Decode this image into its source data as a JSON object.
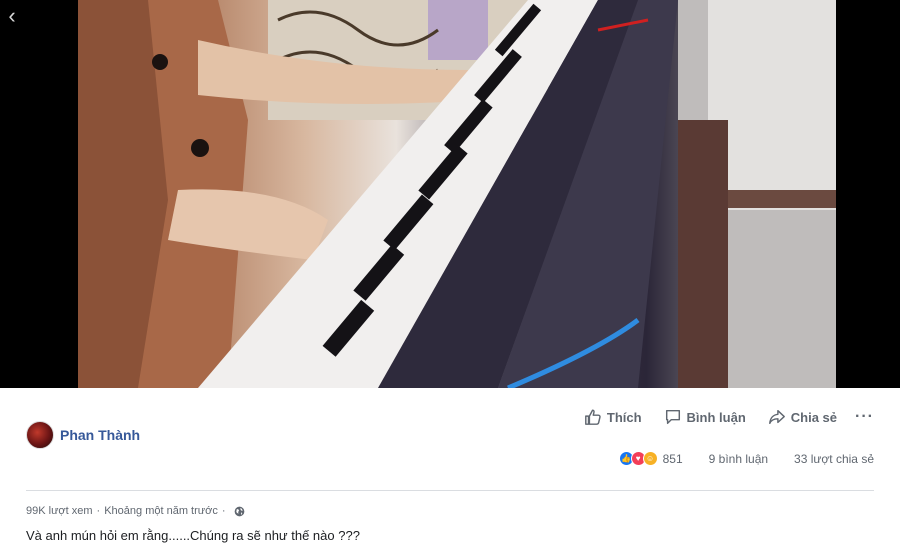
{
  "author": {
    "name": "Phan Thành"
  },
  "actions": {
    "like": "Thích",
    "comment": "Bình luận",
    "share": "Chia sẻ"
  },
  "stats": {
    "reaction_count": "851",
    "comments": "9 bình luận",
    "shares": "33 lượt chia sẻ"
  },
  "meta": {
    "views": "99K lượt xem",
    "separator": "·",
    "time": "Khoảng một năm trước",
    "separator2": "·"
  },
  "caption": "Và anh mún hỏi em rằng......Chúng ra sẽ như thế nào ???",
  "colors": {
    "link": "#365899",
    "like": "#1877f2",
    "love": "#f33e58",
    "haha": "#f7b125",
    "muted": "#606770"
  },
  "icons": {
    "back": "chevron-left-icon",
    "like": "thumbs-up-icon",
    "comment": "comment-bubble-icon",
    "share": "share-arrow-icon",
    "more": "more-dots-icon",
    "privacy": "globe-icon"
  }
}
